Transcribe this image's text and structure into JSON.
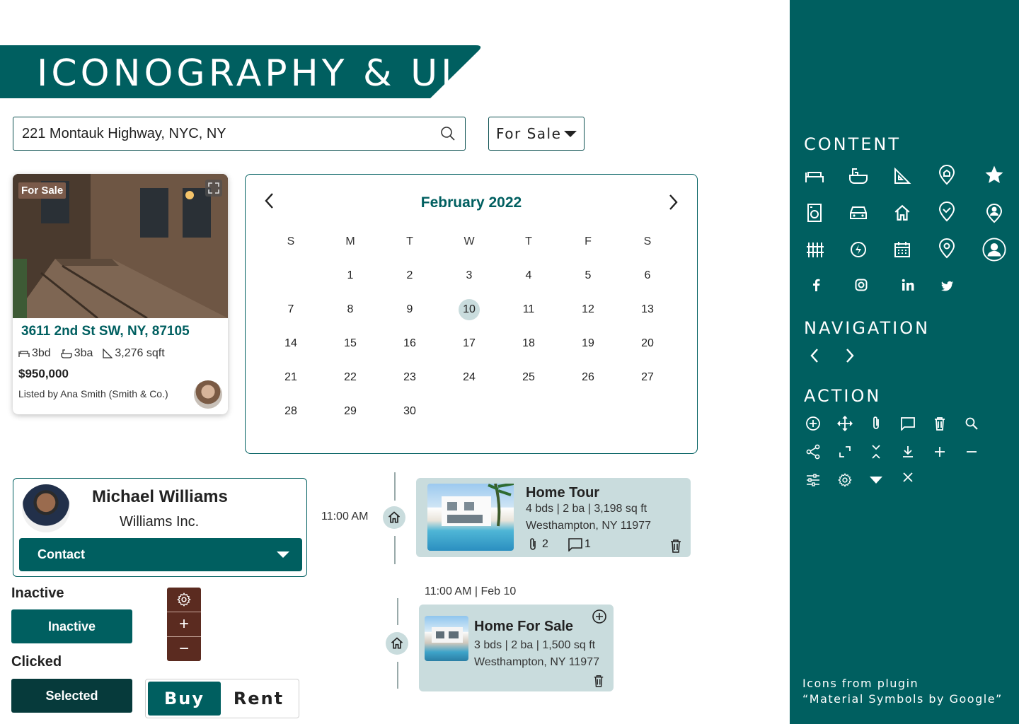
{
  "header": {
    "title": "ICONOGRAPHY & UI"
  },
  "search": {
    "value": "221 Montauk Highway, NYC, NY",
    "icon": "search-icon"
  },
  "filter": {
    "selected": "For Sale"
  },
  "listing": {
    "badge": "For Sale",
    "address": "3611 2nd St SW, NY, 87105",
    "beds": "3bd",
    "baths": "3ba",
    "sqft": "3,276 sqft",
    "price": "$950,000",
    "listed_by": "Listed by Ana Smith (Smith & Co.)"
  },
  "calendar": {
    "month": "February 2022",
    "weekdays": [
      "S",
      "M",
      "T",
      "W",
      "T",
      "F",
      "S"
    ],
    "selected_day": "10",
    "days": [
      "",
      "1",
      "2",
      "3",
      "4",
      "5",
      "6",
      "7",
      "8",
      "9",
      "10",
      "11",
      "12",
      "13",
      "14",
      "15",
      "16",
      "17",
      "18",
      "19",
      "20",
      "21",
      "22",
      "23",
      "24",
      "25",
      "26",
      "27",
      "28",
      "29",
      "30"
    ]
  },
  "contact": {
    "name": "Michael Williams",
    "company": "Williams Inc.",
    "button": "Contact"
  },
  "states": {
    "inactive_label": "Inactive",
    "inactive_button": "Inactive",
    "clicked_label": "Clicked",
    "selected_button": "Selected",
    "plus": "+",
    "minus": "−"
  },
  "toggle": {
    "buy": "Buy",
    "rent": "Rent"
  },
  "timeline": {
    "event1": {
      "time": "11:00 AM",
      "title": "Home Tour",
      "details": "4 bds | 2 ba | 3,198 sq ft",
      "location": "Westhampton, NY 11977",
      "attachments": "2",
      "comments": "1"
    },
    "event2": {
      "time": "11:00 AM | Feb 10",
      "title": "Home For Sale",
      "details": "3 bds | 2 ba | 1,500 sq ft",
      "location": "Westhampton, NY 11977"
    }
  },
  "panel": {
    "content_heading": "CONTENT",
    "navigation_heading": "NAVIGATION",
    "action_heading": "ACTION",
    "credit_line1": "Icons from plugin",
    "credit_line2": "“Material Symbols by Google”",
    "colors": {
      "primary": "#005f60",
      "dark": "#063a3b",
      "accent_brown": "#5b2b20",
      "light": "#c9dcdd"
    }
  }
}
